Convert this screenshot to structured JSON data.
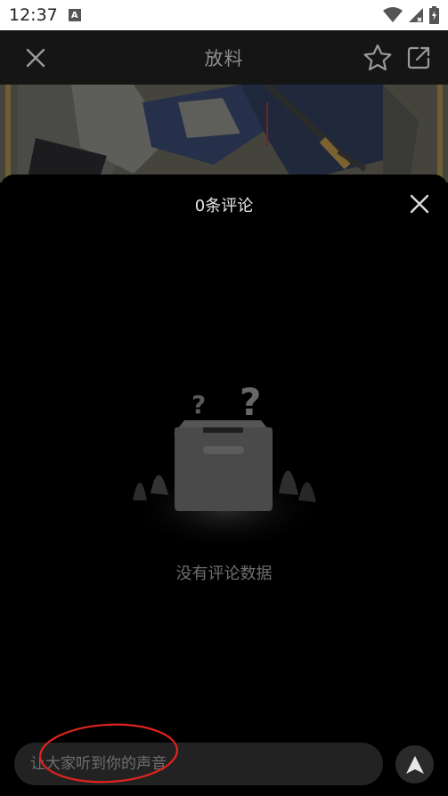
{
  "status_bar": {
    "time": "12:37",
    "notification_letter": "A"
  },
  "header": {
    "title": "放料"
  },
  "comments_panel": {
    "title": "0条评论",
    "empty_text": "没有评论数据",
    "input_placeholder": "让大家听到你的声音"
  },
  "colors": {
    "panel_background": "#000000",
    "header_background": "#151515",
    "input_background": "#222222",
    "annotation": "#e0231f"
  },
  "icons": {
    "header_left": "close-icon",
    "header_fav": "star-icon",
    "header_share": "external-share-icon",
    "panel_close": "close-icon",
    "send": "send-arrow-icon",
    "empty_state": "empty-box-illustration"
  }
}
